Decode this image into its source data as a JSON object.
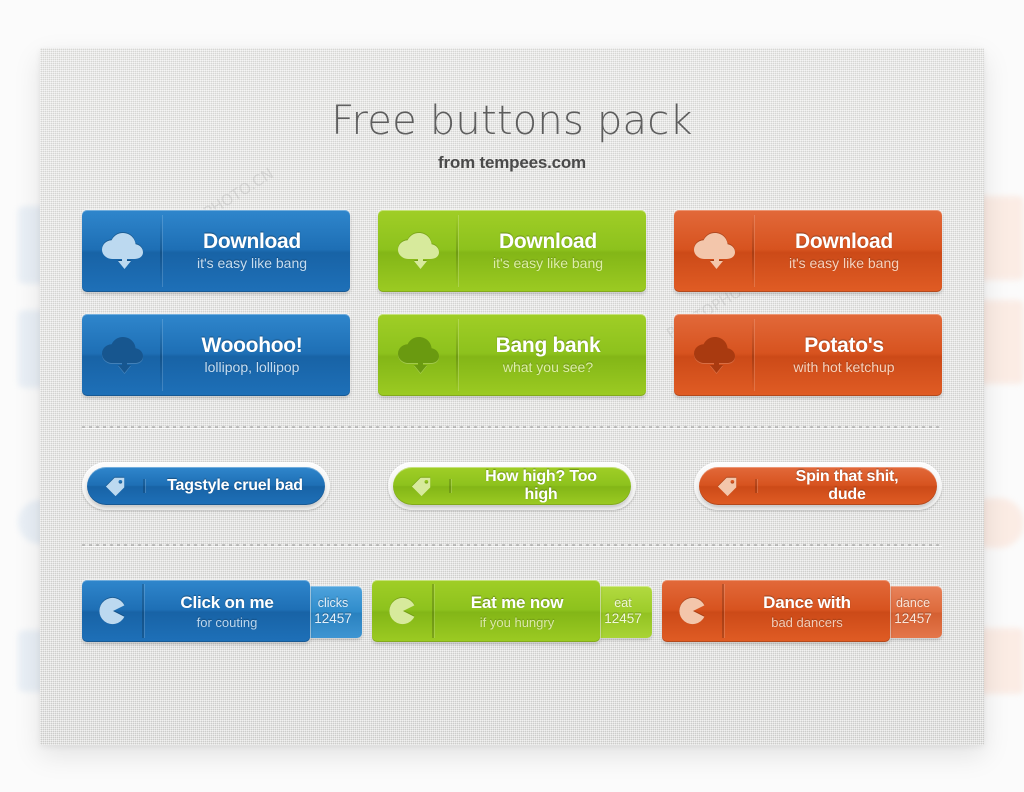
{
  "header": {
    "title": "Free buttons pack",
    "subtitle": "from tempees.com"
  },
  "watermarks": {
    "one": "PHOTOPHOTO.CN",
    "two": "PHOTOPHOTO"
  },
  "colors": {
    "blue": "#1e6fb5",
    "green": "#8dc21d",
    "orange": "#d7531f",
    "panel": "#dcdcda",
    "title_text": "#5e5e5e"
  },
  "rows": {
    "download": {
      "blue": {
        "title": "Download",
        "subtitle": "it's easy like bang",
        "icon": "cloud-download-icon"
      },
      "green": {
        "title": "Download",
        "subtitle": "it's easy like bang",
        "icon": "cloud-download-icon"
      },
      "orange": {
        "title": "Download",
        "subtitle": "it's easy like bang",
        "icon": "cloud-download-icon"
      }
    },
    "pressed": {
      "blue": {
        "title": "Wooohoo!",
        "subtitle": "lollipop, lollipop",
        "icon": "cloud-download-icon"
      },
      "green": {
        "title": "Bang bank",
        "subtitle": "what you see?",
        "icon": "cloud-download-icon"
      },
      "orange": {
        "title": "Potato's",
        "subtitle": "with hot ketchup",
        "icon": "cloud-download-icon"
      }
    },
    "tags": {
      "blue": {
        "title": "Tagstyle cruel bad",
        "icon": "tag-icon"
      },
      "green": {
        "title": "How high? Too high",
        "icon": "tag-icon"
      },
      "orange": {
        "title": "Spin that shit, dude",
        "icon": "tag-icon"
      }
    },
    "counters": {
      "blue": {
        "title": "Click on me",
        "subtitle": "for couting",
        "icon": "pacman-icon",
        "badge_label": "clicks",
        "badge_count": "12457"
      },
      "green": {
        "title": "Eat me now",
        "subtitle": "if you hungry",
        "icon": "pacman-icon",
        "badge_label": "eat",
        "badge_count": "12457"
      },
      "orange": {
        "title": "Dance with",
        "subtitle": "bad dancers",
        "icon": "pacman-icon",
        "badge_label": "dance",
        "badge_count": "12457"
      }
    }
  }
}
